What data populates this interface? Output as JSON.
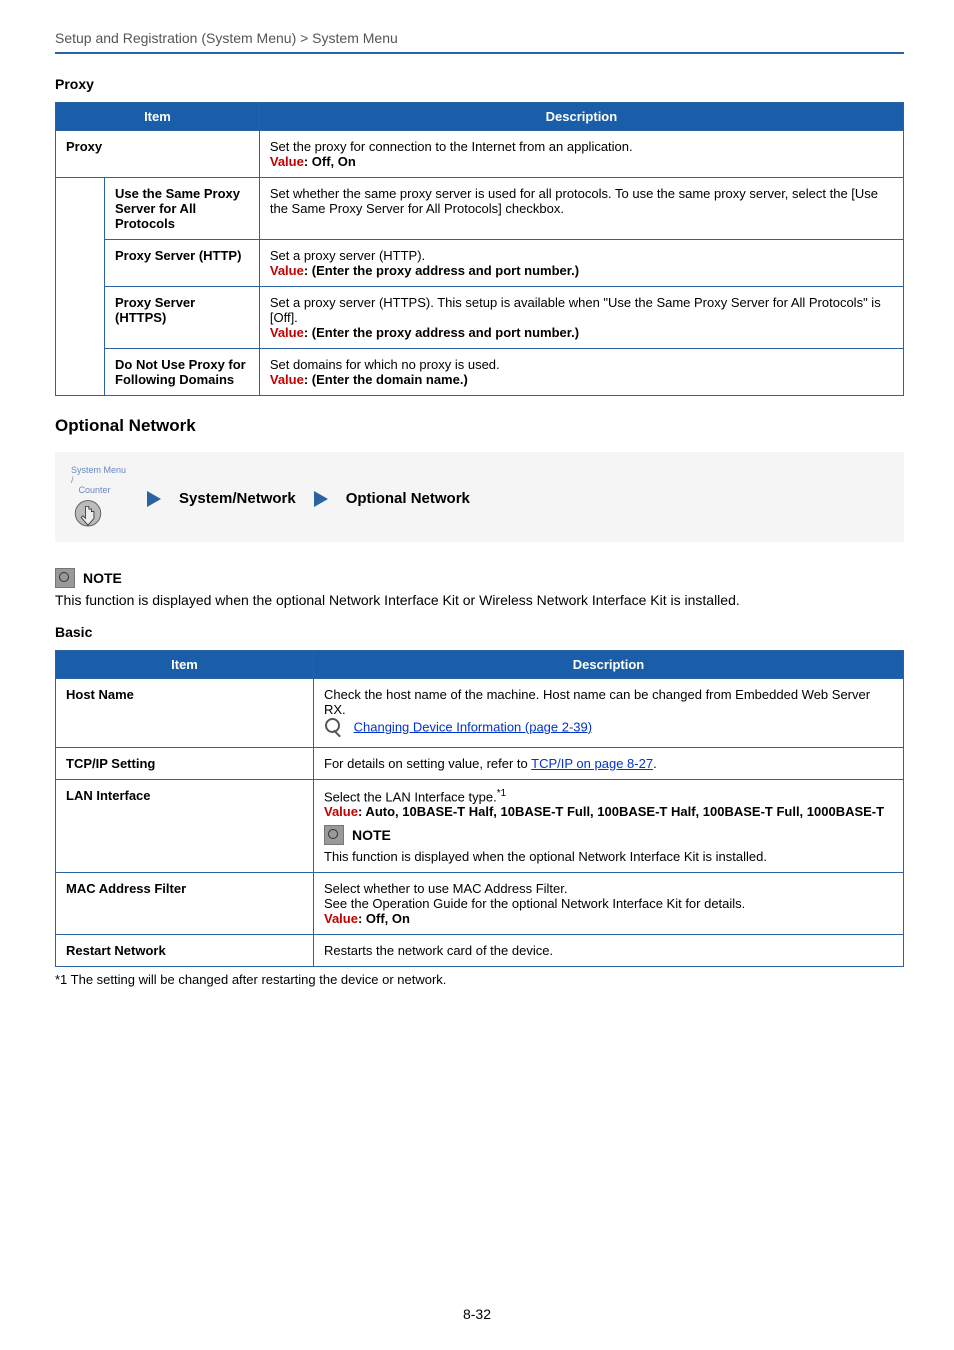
{
  "header": {
    "path": "Setup and Registration (System Menu) > System Menu"
  },
  "proxy_section_title": "Proxy",
  "proxy_table": {
    "head_item": "Item",
    "head_desc": "Description",
    "rows": {
      "proxy": {
        "label": "Proxy",
        "desc_line1": "Set the proxy for connection to the Internet from an application.",
        "value_prefix": "Value",
        "value_text": ": Off, On"
      },
      "same": {
        "label_line1": "Use the Same Proxy",
        "label_line2": "Server for All Protocols",
        "desc": "Set whether the same proxy server is used for all protocols. To use the same proxy server, select the [Use the Same Proxy Server for All Protocols] checkbox."
      },
      "http": {
        "label": "Proxy Server (HTTP)",
        "desc_line1": "Set a proxy server (HTTP).",
        "value_prefix": "Value",
        "value_text": ": (Enter the proxy address and port number.)"
      },
      "https": {
        "label": "Proxy Server (HTTPS)",
        "desc_line1": "Set a proxy server (HTTPS). This setup is available when \"Use the Same Proxy Server for All Protocols\" is [Off].",
        "value_prefix": "Value",
        "value_text": ": (Enter the proxy address and port number.)"
      },
      "domains": {
        "label_line1": "Do Not Use Proxy for",
        "label_line2": "Following Domains",
        "desc_line1": "Set domains for which no proxy is used.",
        "value_prefix": "Value",
        "value_text": ": (Enter the domain name.)"
      }
    }
  },
  "optional_network_title": "Optional Network",
  "nav": {
    "smc_line1": "System Menu /",
    "smc_line2": "Counter",
    "crumb1": "System/Network",
    "crumb2": "Optional Network"
  },
  "outer_note": {
    "label": "NOTE",
    "text": "This function is displayed when the optional Network Interface Kit or Wireless Network Interface Kit is installed."
  },
  "basic_section_title": "Basic",
  "basic_table": {
    "head_item": "Item",
    "head_desc": "Description",
    "rows": {
      "host": {
        "label": "Host Name",
        "desc_line1": "Check the host name of the machine. Host name can be changed from Embedded Web Server RX.",
        "link_text": "Changing Device Information (page 2-39)"
      },
      "tcpip": {
        "label": "TCP/IP Setting",
        "desc_prefix": "For details on setting value, refer to ",
        "link_text": "TCP/IP on page 8-27",
        "desc_suffix": "."
      },
      "lan": {
        "label": "LAN Interface",
        "desc_line1": "Select the LAN Interface type.",
        "footnote_marker": "*1",
        "value_prefix": "Value",
        "value_text": ": Auto, 10BASE-T Half, 10BASE-T Full, 100BASE-T Half, 100BASE-T Full, 1000BASE-T",
        "note_label": "NOTE",
        "note_text": "This function is displayed when the optional Network Interface Kit is installed."
      },
      "mac": {
        "label": "MAC Address Filter",
        "desc_line1": "Select whether to use MAC Address Filter.",
        "desc_line2": "See the Operation Guide for the optional Network Interface Kit for details.",
        "value_prefix": "Value",
        "value_text": ": Off, On"
      },
      "restart": {
        "label": "Restart Network",
        "desc": "Restarts the network card of the device."
      }
    }
  },
  "footnote": "*1   The setting will be changed after restarting the device or network.",
  "page_number": "8-32"
}
